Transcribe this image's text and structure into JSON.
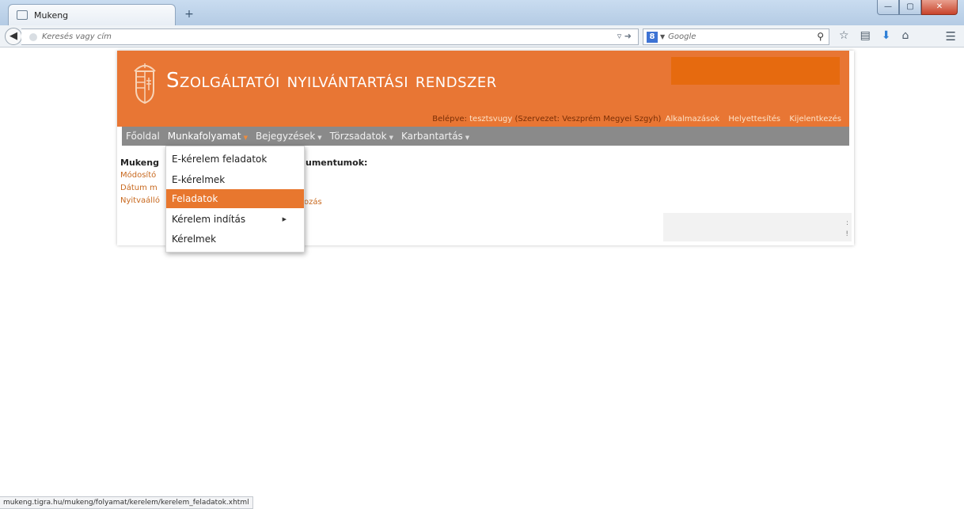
{
  "browser": {
    "tab_title": "Mukeng",
    "new_tab": "+",
    "url_placeholder": "Keresés vagy cím",
    "search_placeholder": "Google",
    "search_engine_icon": "google-icon",
    "status_url": "mukeng.tigra.hu/mukeng/folyamat/kerelem/kerelem_feladatok.xhtml"
  },
  "header": {
    "title": "Szolgáltatói nyilvántartási rendszer",
    "logged_in_label": "Belépve:",
    "username": "tesztsvugy",
    "organization": "(Szervezet: Veszprém Megyei Szgyh)",
    "links": [
      "Alkalmazások",
      "Helyettesítés",
      "Kijelentkezés"
    ]
  },
  "nav": {
    "items": [
      "Főoldal",
      "Munkafolyamat",
      "Bejegyzések",
      "Törzsadatok",
      "Karbantartás"
    ],
    "active": "Munkafolyamat"
  },
  "dropdown": {
    "items": [
      "E-kérelem feladatok",
      "E-kérelmek",
      "Feladatok",
      "Kérelem indítás",
      "Kérelmek"
    ],
    "selected": "Feladatok",
    "submenu_item": "Kérelem indítás"
  },
  "content": {
    "heading_left": "Mukeng",
    "heading_right": "umentumok:",
    "links": [
      "Módosító",
      "Dátum m",
      "Nyitvaálló"
    ],
    "link_right": "ozás",
    "greybox_marks": [
      ":",
      "!"
    ]
  },
  "colors": {
    "brand_orange": "#e87634",
    "nav_grey": "#8a8a8a",
    "link_orange": "#c8691f"
  }
}
